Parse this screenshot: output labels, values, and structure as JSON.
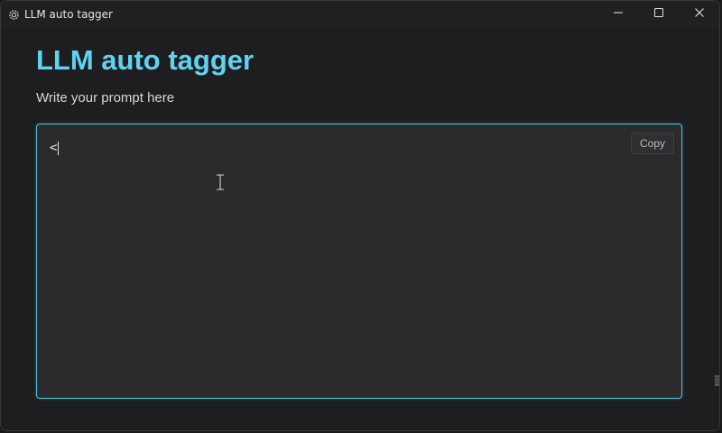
{
  "window": {
    "title": "LLM auto tagger",
    "controls": {
      "minimize": "minimize-icon",
      "maximize": "maximize-icon",
      "close": "close-icon"
    }
  },
  "page": {
    "title": "LLM auto tagger",
    "subtitle": "Write your prompt here"
  },
  "prompt": {
    "value": "<",
    "copy_label": "Copy"
  },
  "colors": {
    "accent": "#5ed4f2",
    "focus_border": "#4cc3dc",
    "background": "#1e1e20",
    "textarea_bg": "#2c2b2c"
  },
  "icons": {
    "app": "app-gear-icon",
    "cursor": "text-cursor-icon"
  }
}
